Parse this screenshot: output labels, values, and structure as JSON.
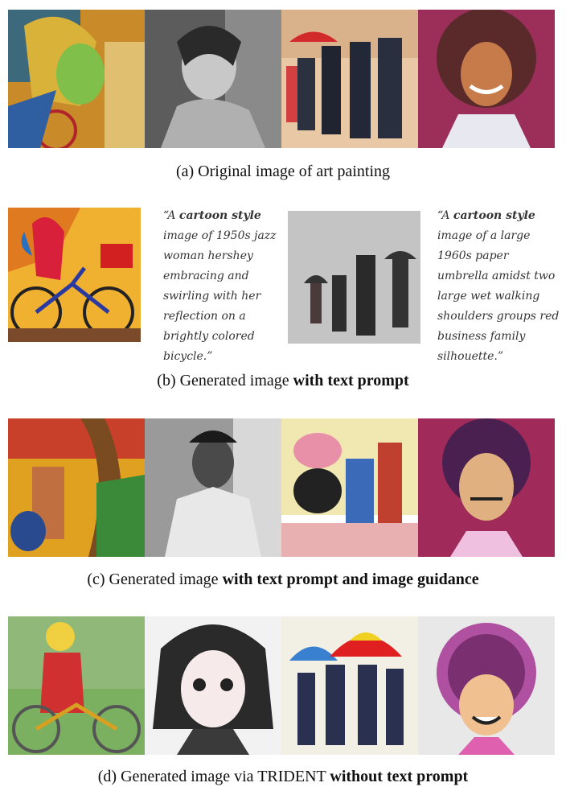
{
  "captions": {
    "a": "(a) Original image of art painting",
    "b_pre": "(b) Generated image ",
    "b_bold": "with text prompt",
    "c_pre": "(c) Generated image ",
    "c_bold": "with text prompt and image guidance",
    "d_pre": "(d) Generated image via TRIDENT ",
    "d_bold": "without text prompt"
  },
  "prompts": [
    {
      "open": "“A ",
      "bold": "cartoon style",
      "lines": [
        "image of 1950s jazz",
        "woman hershey",
        "embracing and",
        "swirling with her",
        "reflection on a",
        "brightly colored",
        "bicycle.”"
      ]
    },
    {
      "open": "“A ",
      "bold": "cartoon style",
      "lines": [
        "image of a large",
        "1960s paper",
        "umbrella amidst two",
        "large wet walking",
        "shoulders groups red",
        "business family",
        "silhouette.”"
      ]
    }
  ]
}
